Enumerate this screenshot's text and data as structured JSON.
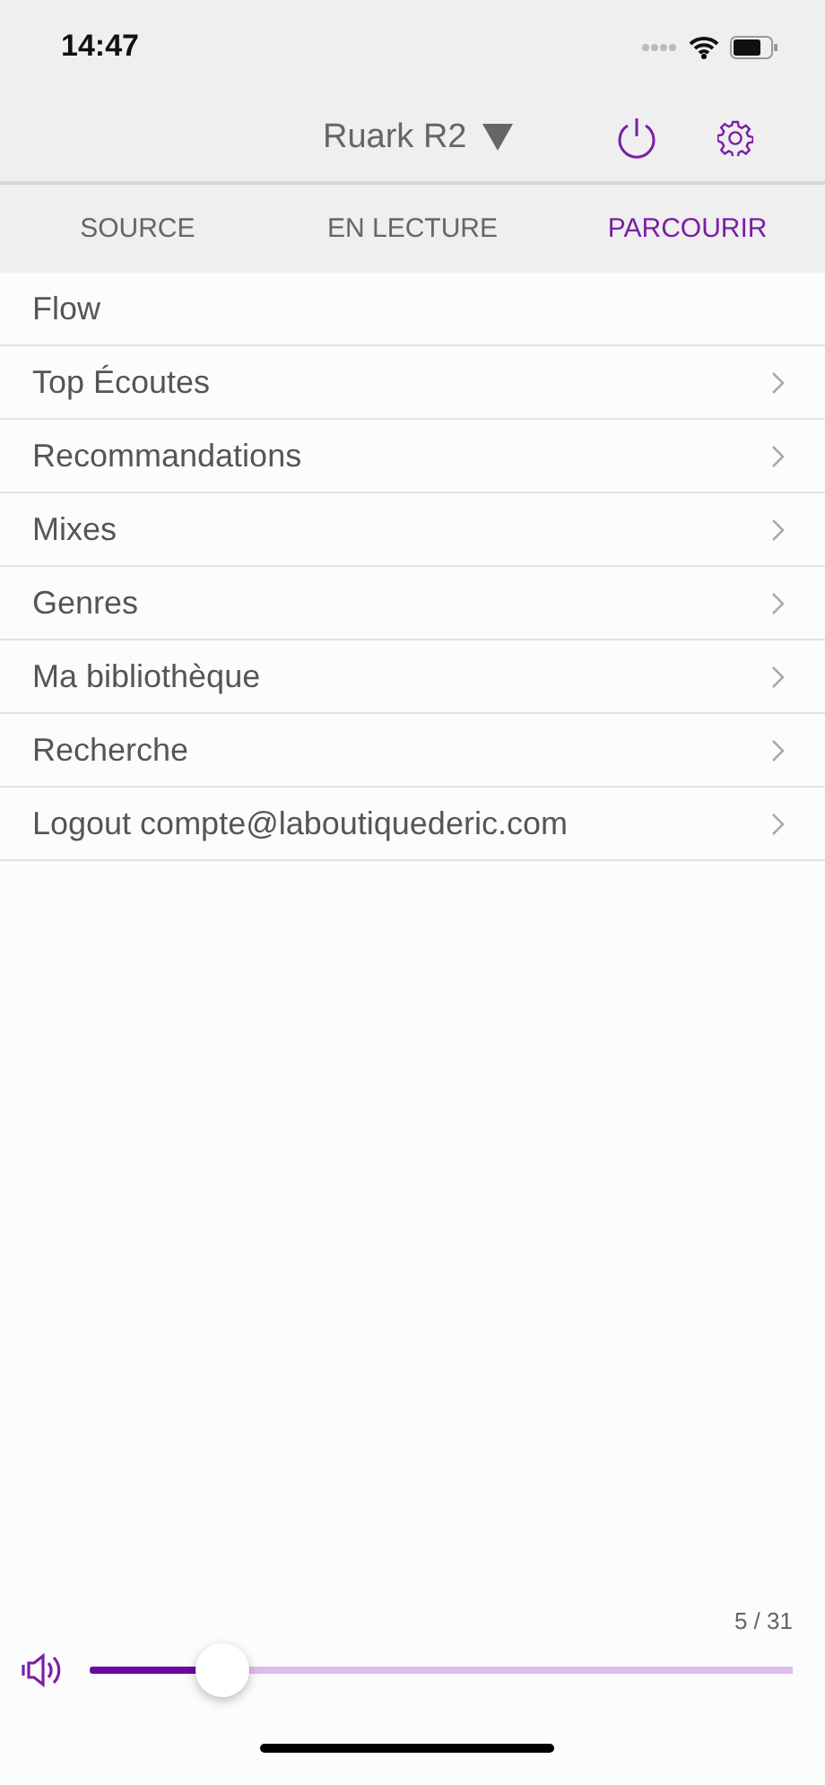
{
  "status_bar": {
    "time": "14:47"
  },
  "header": {
    "device": "Ruark R2"
  },
  "tabs": [
    {
      "label": "SOURCE",
      "selected": false
    },
    {
      "label": "EN LECTURE",
      "selected": false
    },
    {
      "label": "PARCOURIR",
      "selected": true
    }
  ],
  "items": [
    {
      "label": "Flow",
      "chevron": false
    },
    {
      "label": "Top Écoutes",
      "chevron": true
    },
    {
      "label": "Recommandations",
      "chevron": true
    },
    {
      "label": "Mixes",
      "chevron": true
    },
    {
      "label": "Genres",
      "chevron": true
    },
    {
      "label": "Ma bibliothèque",
      "chevron": true
    },
    {
      "label": "Recherche",
      "chevron": true
    },
    {
      "label": "Logout compte@laboutiquederic.com",
      "chevron": true
    }
  ],
  "volume": {
    "reading": "5 / 31",
    "level": 0.19
  }
}
